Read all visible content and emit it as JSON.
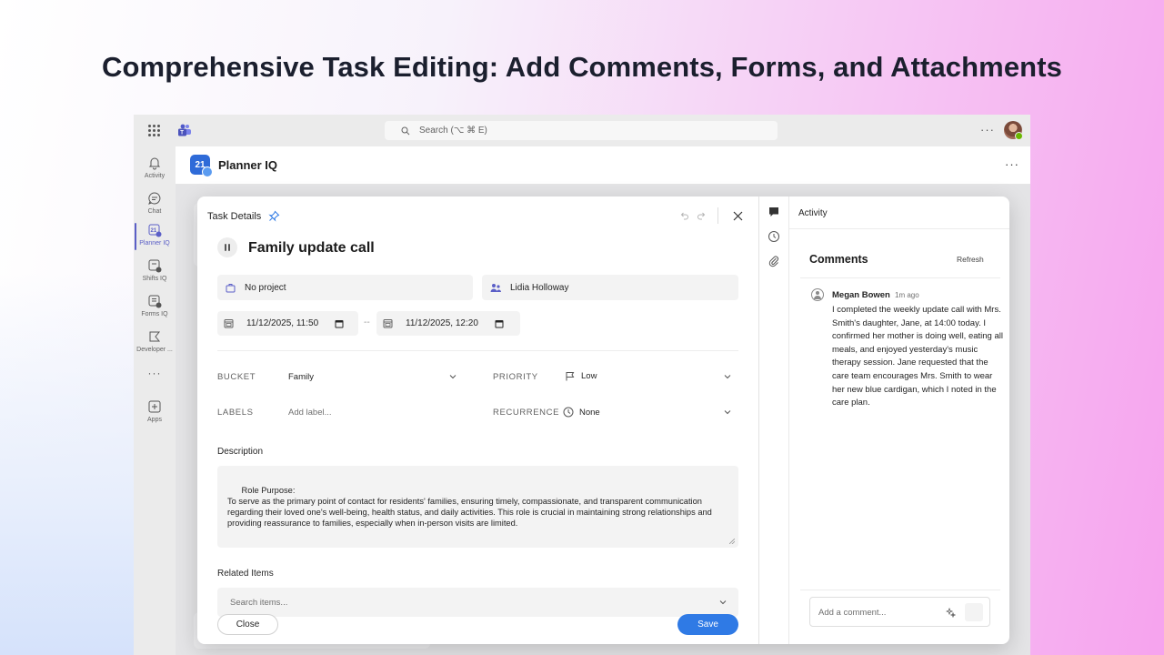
{
  "headline": "Comprehensive Task Editing: Add Comments, Forms, and Attachments",
  "topbar": {
    "search_placeholder": "Search (⌥ ⌘ E)",
    "more": "···"
  },
  "rail": {
    "items": [
      {
        "label": "Activity",
        "icon": "bell-icon"
      },
      {
        "label": "Chat",
        "icon": "chat-icon"
      },
      {
        "label": "Planner IQ",
        "icon": "planner-icon",
        "active": true
      },
      {
        "label": "Shifts IQ",
        "icon": "shifts-icon"
      },
      {
        "label": "Forms IQ",
        "icon": "forms-icon"
      },
      {
        "label": "Developer ...",
        "icon": "developer-icon"
      }
    ],
    "more": "···",
    "apps_label": "Apps"
  },
  "app": {
    "name": "Planner IQ",
    "logo_text": "21",
    "more": "···"
  },
  "dialog": {
    "header_title": "Task Details",
    "task_title": "Family update call",
    "project": "No project",
    "assignee": "Lidia Holloway",
    "start_datetime": "11/12/2025, 11:50",
    "end_datetime": "11/12/2025, 12:20",
    "date_separator": "--",
    "fields": {
      "bucket_label": "BUCKET",
      "bucket_value": "Family",
      "priority_label": "PRIORITY",
      "priority_value": "Low",
      "labels_label": "LABELS",
      "labels_placeholder": "Add label...",
      "recurrence_label": "RECURRENCE",
      "recurrence_value": "None"
    },
    "description_label": "Description",
    "description_text": "Role Purpose:\nTo serve as the primary point of contact for residents' families, ensuring timely, compassionate, and transparent communication regarding their loved one's well-being, health status, and daily activities. This role is crucial in maintaining strong relationships and providing reassurance to families, especially when in-person visits are limited.",
    "related_label": "Related Items",
    "related_placeholder": "Search items...",
    "close_label": "Close",
    "save_label": "Save"
  },
  "side": {
    "title": "Activity",
    "comments_title": "Comments",
    "refresh_label": "Refresh",
    "comment": {
      "author": "Megan Bowen",
      "time": "1m ago",
      "body": "I completed the weekly update call with Mrs. Smith's daughter, Jane, at 14:00 today. I confirmed her mother is doing well, eating all meals, and enjoyed yesterday's music therapy session. Jane requested that the care team encourages Mrs. Smith to wear her new blue cardigan, which I noted in the care plan."
    },
    "comment_placeholder": "Add a comment..."
  },
  "colors": {
    "accent": "#2f7ae5",
    "rail_active": "#5b5fc7",
    "presence": "#6bb700"
  }
}
